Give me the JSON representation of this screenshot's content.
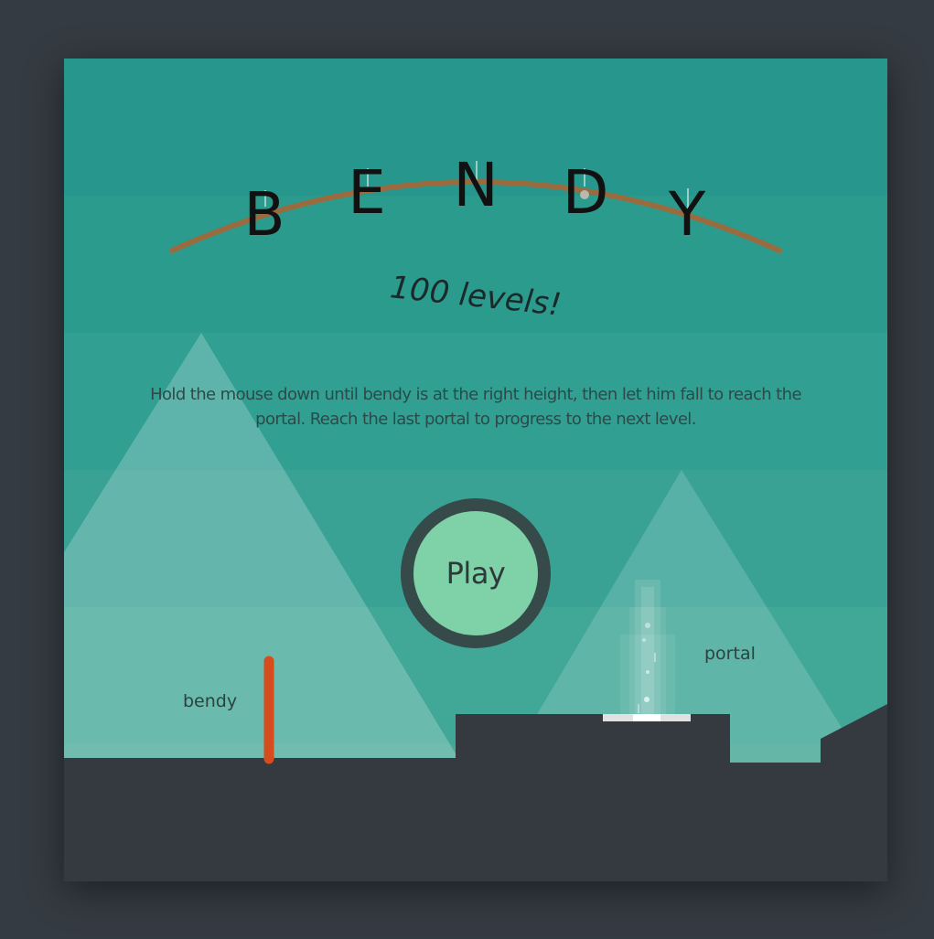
{
  "game": {
    "title_letters": [
      "B",
      "E",
      "N",
      "D",
      "Y"
    ],
    "subtitle": "100 levels!",
    "instructions": "Hold the mouse down until bendy is at the right height, then let him fall to reach the portal. Reach the last portal to progress to the next level.",
    "play_label": "Play",
    "bendy_label": "bendy",
    "portal_label": "portal"
  },
  "colors": {
    "page_background": "#353b42",
    "sky_bands": [
      "#27968c",
      "#2b9b8e",
      "#319f92",
      "#39a295",
      "#41a797",
      "#49a998"
    ],
    "mountain": "#ffffff",
    "ground": "#353a41",
    "bendy": "#d74c1d",
    "arc": "#9a6b3f",
    "play_ring": "#364a4a",
    "play_fill": "#7fd1a8",
    "portal_beam": "#ffffff"
  }
}
